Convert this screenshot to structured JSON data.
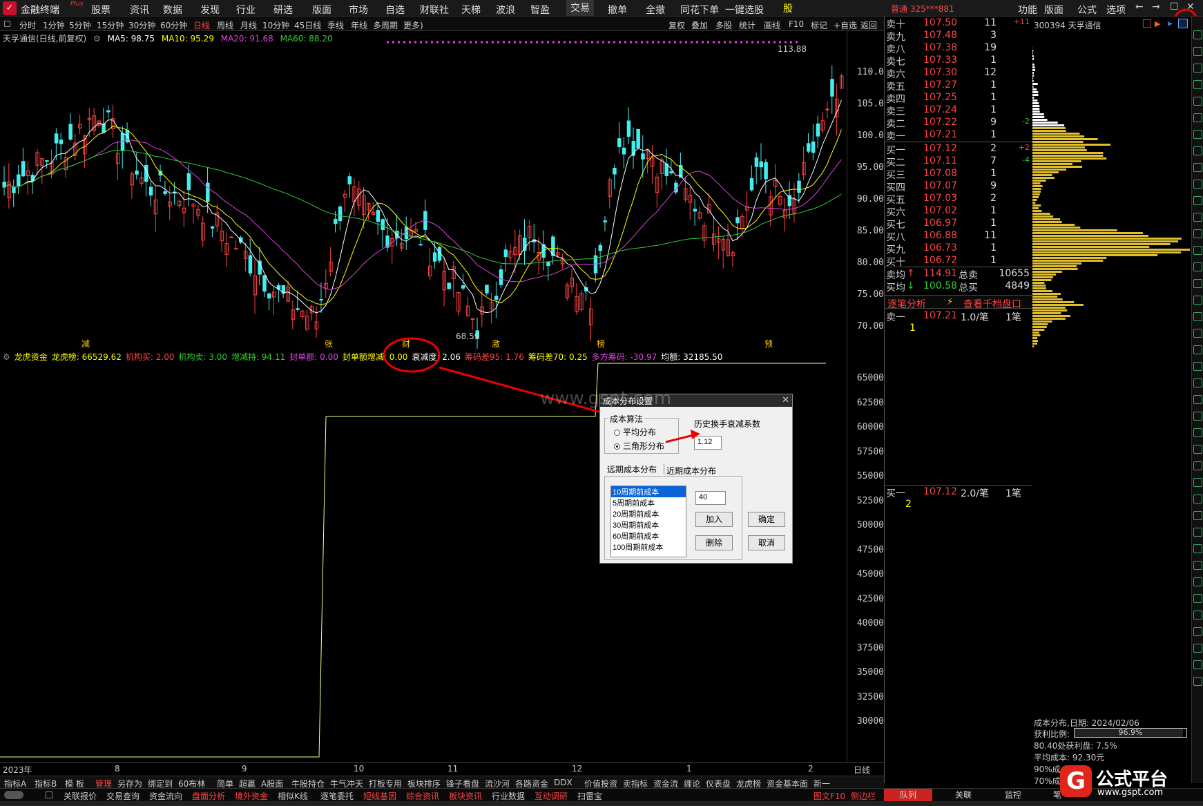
{
  "topbar": {
    "app": "金融终端",
    "plus": "Plus",
    "menus": [
      "股票",
      "资讯",
      "数据",
      "发现",
      "行业",
      "研选",
      "版面",
      "市场",
      "自选",
      "财联社",
      "天梯",
      "波浪",
      "智盈",
      "交易",
      "撤单",
      "全撤",
      "同花下单",
      "一键选股"
    ],
    "active_menu": "交易",
    "account": "普通 325***881",
    "right_menus": [
      "功能",
      "版面",
      "公式",
      "选项"
    ]
  },
  "periods": [
    "分时",
    "1分钟",
    "5分钟",
    "15分钟",
    "30分钟",
    "60分钟",
    "日线",
    "周线",
    "月线",
    "10分钟",
    "45日线",
    "季线",
    "年线",
    "多周期",
    "更多)"
  ],
  "active_period": "日线",
  "toolbar_right": [
    "复权",
    "叠加",
    "多股",
    "统计",
    "画线",
    "F10",
    "标记",
    "+自选",
    "返回"
  ],
  "main": {
    "stock": "天孚通信(日线,前复权)",
    "ma5": "MA5: 98.75",
    "ma10": "MA10: 95.29",
    "ma20": "MA20: 91.68",
    "ma60": "MA60: 88.20",
    "high_label": "113.88",
    "low_label": "68.59",
    "yticks": [
      "110.0",
      "105.0",
      "100.0",
      "95.00",
      "90.00",
      "85.00",
      "80.00",
      "75.00",
      "70.00"
    ],
    "markers": [
      "减",
      "张",
      "财",
      "激",
      "榜",
      "预"
    ]
  },
  "sub": {
    "name": "龙虎资金",
    "items": [
      {
        "t": "龙虎榜: 66529.62",
        "c": "#ff0"
      },
      {
        "t": "机构买: 2.00",
        "c": "#f44"
      },
      {
        "t": "机构卖: 3.00",
        "c": "#3c3"
      },
      {
        "t": "增减持: 94.11",
        "c": "#3c3"
      },
      {
        "t": "封单额: 0.00",
        "c": "#d4d"
      },
      {
        "t": "封单额增减: 0.00",
        "c": "#ff0"
      },
      {
        "t": "衰减度: 2.06",
        "c": "#fff"
      },
      {
        "t": "筹码差95: 1.76",
        "c": "#f44"
      },
      {
        "t": "筹码差70: 0.25",
        "c": "#ff0"
      },
      {
        "t": "多方筹码: -30.97",
        "c": "#d4d"
      },
      {
        "t": "均额: 32185.50",
        "c": "#fff"
      }
    ],
    "yticks": [
      "65000",
      "62500",
      "60000",
      "57500",
      "55000",
      "52500",
      "50000",
      "47500",
      "45000",
      "42500",
      "40000",
      "37500",
      "35000",
      "32500",
      "30000"
    ]
  },
  "xaxis": [
    "2023年",
    "8",
    "9",
    "10",
    "11",
    "12",
    "1",
    "2",
    "日线"
  ],
  "orderbook": {
    "asks": [
      [
        "卖十",
        "107.50",
        "11",
        "+11"
      ],
      [
        "卖九",
        "107.48",
        "3",
        ""
      ],
      [
        "卖八",
        "107.38",
        "19",
        ""
      ],
      [
        "卖七",
        "107.33",
        "1",
        ""
      ],
      [
        "卖六",
        "107.30",
        "12",
        ""
      ],
      [
        "卖五",
        "107.27",
        "1",
        ""
      ],
      [
        "卖四",
        "107.25",
        "1",
        ""
      ],
      [
        "卖三",
        "107.24",
        "1",
        ""
      ],
      [
        "卖二",
        "107.22",
        "9",
        "-2"
      ],
      [
        "卖一",
        "107.21",
        "1",
        ""
      ]
    ],
    "bids": [
      [
        "买一",
        "107.12",
        "2",
        "+2"
      ],
      [
        "买二",
        "107.11",
        "7",
        "-4"
      ],
      [
        "买三",
        "107.08",
        "1",
        ""
      ],
      [
        "买四",
        "107.07",
        "9",
        ""
      ],
      [
        "买五",
        "107.03",
        "2",
        ""
      ],
      [
        "买六",
        "107.02",
        "1",
        ""
      ],
      [
        "买七",
        "106.97",
        "1",
        ""
      ],
      [
        "买八",
        "106.88",
        "11",
        ""
      ],
      [
        "买九",
        "106.73",
        "1",
        ""
      ],
      [
        "买十",
        "106.72",
        "1",
        ""
      ]
    ],
    "avg_sell": "114.91",
    "total_sell_label": "总卖",
    "total_sell": "10655",
    "avg_buy": "100.58",
    "total_buy_label": "总买",
    "total_buy": "4849",
    "avg_sell_label": "卖均",
    "avg_buy_label": "买均",
    "tab1": "逐笔分析",
    "tab2": "查看千档盘口",
    "tick1": {
      "side": "卖一",
      "price": "107.21",
      "per": "1.0/笔",
      "count": "1笔",
      "n": "1"
    },
    "tick2": {
      "side": "买一",
      "price": "107.12",
      "per": "2.0/笔",
      "count": "1笔",
      "n": "2"
    }
  },
  "cost": {
    "stock": "300394 天孚通信",
    "date": "成本分布,日期: 2024/02/06",
    "profit_label": "获利比例:",
    "profit": "96.9%",
    "profit_frac": 0.969,
    "line3": "80.40处获利盘: 7.5%",
    "line4": "平均成本: 92.30元",
    "line5": "90%成",
    "line6": "70%成"
  },
  "dialog": {
    "title": "成本分布设置",
    "algo_label": "成本算法",
    "opt1": "平均分布",
    "opt2": "三角形分布",
    "decay_label": "历史换手衰减系数",
    "decay_value": "1.12",
    "tab1": "远期成本分布",
    "tab2": "近期成本分布",
    "list": [
      "10周期前成本",
      "5周期前成本",
      "20周期前成本",
      "30周期前成本",
      "60周期前成本",
      "100周期前成本"
    ],
    "period_value": "40",
    "add": "加入",
    "del": "删除",
    "ok": "确定",
    "cancel": "取消"
  },
  "watermark": "www.gspt.com",
  "bottom1": [
    "指标A",
    "指标B",
    "模 板",
    "管理",
    "另存为",
    "绑定到",
    "60布林",
    "简单",
    "超赢",
    "A股面",
    "牛股持仓",
    "牛气冲天",
    "打板专用",
    "板块排序",
    "锋子看盘",
    "流沙河",
    "各路资金",
    "DDX",
    "价值投资",
    "卖指标",
    "资金流",
    "缠论",
    "仪表盘",
    "龙虎榜",
    "资金基本面",
    "新一"
  ],
  "bottom2": [
    "关联报价",
    "交易查询",
    "资金流向",
    "盘面分析",
    "境外资金",
    "相似K线",
    "逐笔委托",
    "短线基因",
    "综合资讯",
    "板块资讯",
    "行业数据",
    "互动调研",
    "扫雷宝"
  ],
  "bottom2_right": [
    "图文F10",
    "侧边栏"
  ],
  "bottom_tabs": [
    "队列",
    "关联",
    "监控",
    "笔"
  ],
  "logo": {
    "text1": "公式平台",
    "text2": "www.gspt.com"
  }
}
